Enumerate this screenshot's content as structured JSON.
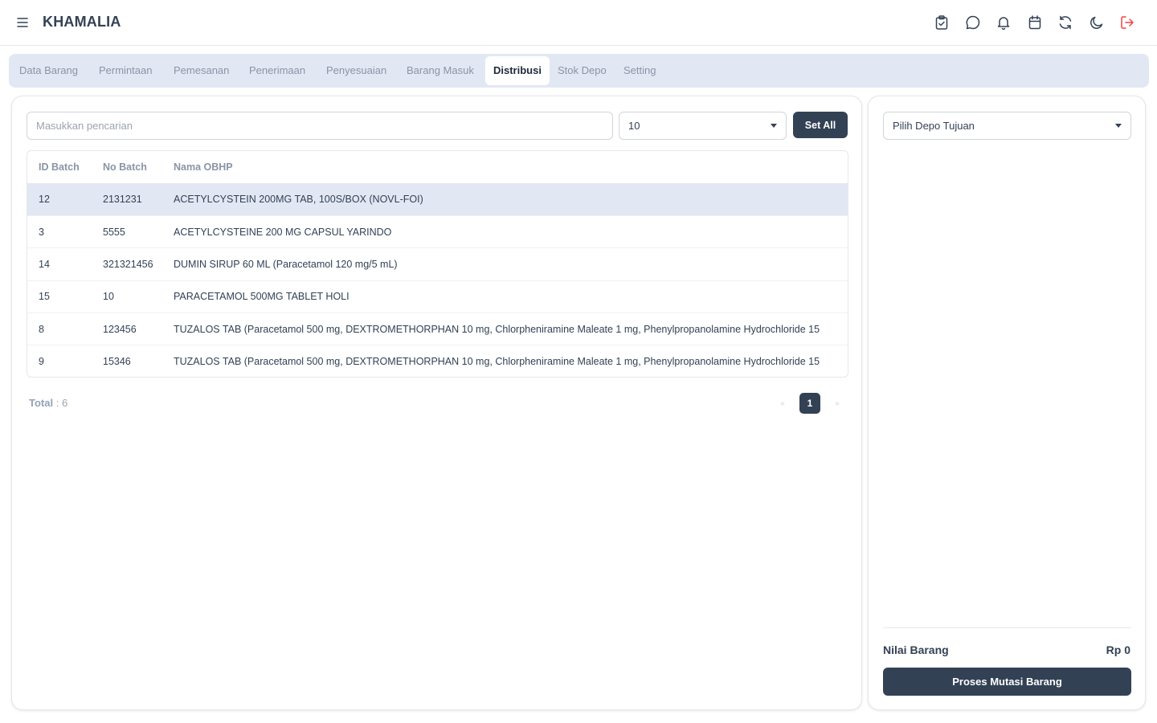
{
  "app": {
    "brand": "KHAMALIA"
  },
  "topbar": {
    "icons": [
      "clipboard-check-icon",
      "chat-icon",
      "bell-icon",
      "calendar-icon",
      "refresh-icon",
      "moon-icon",
      "logout-icon"
    ],
    "logout_color": "#ef4444"
  },
  "tabs": [
    {
      "label": "Data Barang",
      "active": false
    },
    {
      "label": "Permintaan",
      "active": false
    },
    {
      "label": "Pemesanan",
      "active": false
    },
    {
      "label": "Penerimaan",
      "active": false
    },
    {
      "label": "Penyesuaian",
      "active": false
    },
    {
      "label": "Barang Masuk",
      "active": false
    },
    {
      "label": "Distribusi",
      "active": true
    },
    {
      "label": "Stok Depo",
      "active": false
    },
    {
      "label": "Setting",
      "active": false
    }
  ],
  "left": {
    "search": {
      "placeholder": "Masukkan pencarian",
      "value": ""
    },
    "per_page": "10",
    "set_all_label": "Set All",
    "table": {
      "headers": [
        "ID Batch",
        "No Batch",
        "Nama OBHP"
      ],
      "rows": [
        {
          "id": "12",
          "no": "2131231",
          "nama": "ACETYLCYSTEIN 200MG TAB, 100S/BOX (NOVL-FOI)",
          "selected": true
        },
        {
          "id": "3",
          "no": "5555",
          "nama": "ACETYLCYSTEINE 200 MG CAPSUL YARINDO",
          "selected": false
        },
        {
          "id": "14",
          "no": "321321456",
          "nama": "DUMIN SIRUP 60 ML (Paracetamol 120 mg/5 mL)",
          "selected": false
        },
        {
          "id": "15",
          "no": "10",
          "nama": "PARACETAMOL 500MG TABLET HOLI",
          "selected": false
        },
        {
          "id": "8",
          "no": "123456",
          "nama": "TUZALOS TAB (Paracetamol 500 mg, DEXTROMETHORPHAN 10 mg, Chlorpheniramine Maleate 1 mg, Phenylpropanolamine Hydrochloride 15",
          "selected": false
        },
        {
          "id": "9",
          "no": "15346",
          "nama": "TUZALOS TAB (Paracetamol 500 mg, DEXTROMETHORPHAN 10 mg, Chlorpheniramine Maleate 1 mg, Phenylpropanolamine Hydrochloride 15",
          "selected": false
        }
      ]
    },
    "total_label": "Total",
    "total_value": ": 6",
    "pagination": {
      "prev": "«",
      "current": "1",
      "next": "»"
    }
  },
  "right": {
    "depo_placeholder": "Pilih Depo Tujuan",
    "nilai_label": "Nilai Barang",
    "nilai_value": "Rp 0",
    "proses_label": "Proses Mutasi Barang"
  },
  "colors": {
    "primary": "#334155",
    "tabbar_bg": "#e2e8f3",
    "selected_row": "#e2e8f3"
  }
}
